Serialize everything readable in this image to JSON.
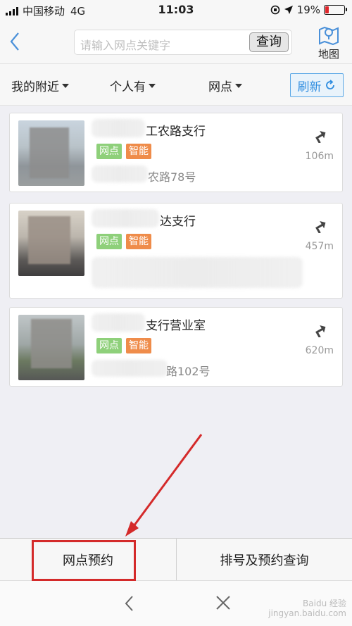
{
  "status_bar": {
    "carrier": "中国移动",
    "network": "4G",
    "time": "11:03",
    "battery": "19%",
    "battery_level": 0.19,
    "battery_color": "#e0262b"
  },
  "header": {
    "back_icon": "chevron-left-icon",
    "search_placeholder": "请输入网点关键字",
    "search_button": "查询",
    "map_label": "地图",
    "map_icon": "map-pin-icon"
  },
  "filters": {
    "nearby": "我的附近",
    "personal": "个人有",
    "outlet": "网点",
    "refresh": "刷新"
  },
  "branches": [
    {
      "name": "工农路支行",
      "tags": [
        "网点",
        "智能"
      ],
      "address": "农路78号",
      "distance": "106m"
    },
    {
      "name": "达支行",
      "tags": [
        "网点",
        "智能"
      ],
      "address": "",
      "distance": "457m"
    },
    {
      "name": "支行营业室",
      "tags": [
        "网点",
        "智能"
      ],
      "address": "路102号",
      "distance": "620m"
    }
  ],
  "bottom_tabs": {
    "appointment": "网点预约",
    "query": "排号及预约查询"
  },
  "browser": {
    "back_icon": "chevron-left-icon",
    "close_icon": "close-icon"
  },
  "watermark": {
    "line1": "Baidu 经验",
    "line2": "jingyan.baidu.com"
  },
  "colors": {
    "accent": "#2f8de0",
    "tag_green": "#8ed07a",
    "tag_orange": "#ef8c4a",
    "annotation_red": "#d42a2a"
  }
}
